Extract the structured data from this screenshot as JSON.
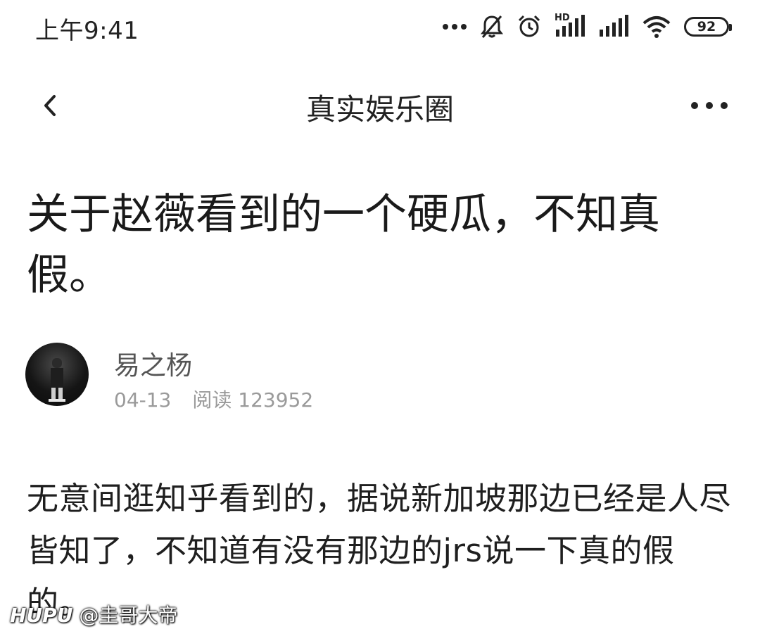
{
  "status_bar": {
    "time": "上午9:41",
    "network_label": "HD",
    "battery_level": "92",
    "icons": [
      "more-dots-icon",
      "mute-bell-icon",
      "alarm-icon",
      "signal-icon",
      "signal-icon",
      "wifi-icon",
      "battery-icon"
    ]
  },
  "nav": {
    "title": "真实娱乐圈",
    "back_icon": "chevron-left-icon",
    "more_icon": "more-horizontal-icon"
  },
  "post": {
    "title": "关于赵薇看到的一个硬瓜，不知真假。",
    "author": {
      "name": "易之杨",
      "date": "04-13",
      "reads_label": "阅读",
      "reads_count": "123952"
    },
    "body": "无意间逛知乎看到的，据说新加坡那边已经是人尽皆知了，不知道有没有那边的jrs说一下真的假的。"
  },
  "watermark": {
    "brand": "HUPU",
    "handle": "@圭哥大帝"
  }
}
